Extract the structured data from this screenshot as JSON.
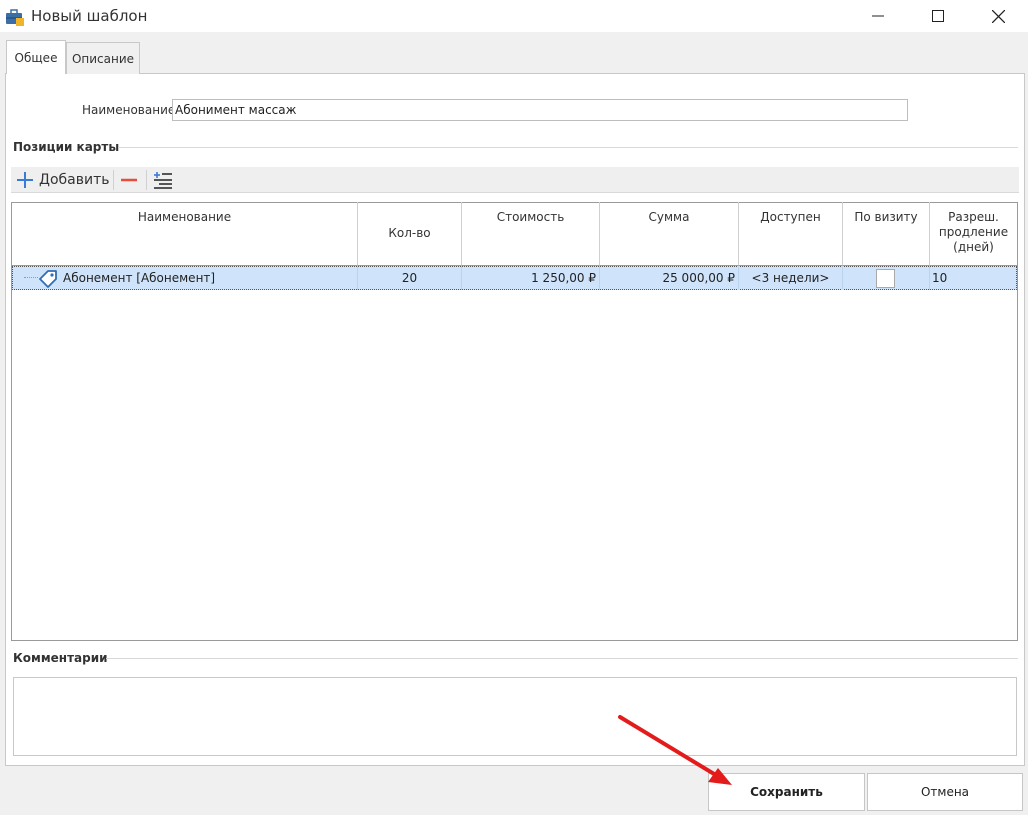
{
  "window": {
    "title": "Новый шаблон",
    "icons": {
      "app": "briefcase-icon",
      "minimize": "minimize-icon",
      "maximize": "maximize-icon",
      "close": "close-icon"
    }
  },
  "tabs": [
    {
      "label": "Общее",
      "active": true
    },
    {
      "label": "Описание",
      "active": false
    }
  ],
  "form": {
    "name_label": "Наименование:",
    "name_value": "Абонимент массаж"
  },
  "positions": {
    "title": "Позиции карты",
    "toolbar": {
      "add_label": "Добавить",
      "add_icon": "plus-icon",
      "remove_icon": "minus-icon",
      "properties_icon": "list-settings-icon"
    },
    "columns": [
      "Наименование",
      "Кол-во",
      "Стоимость",
      "Сумма",
      "Доступен",
      "По визиту",
      "Разреш. продление (дней)"
    ],
    "rows": [
      {
        "icon": "tag-icon",
        "name": "Абонемент [Абонемент]",
        "qty": "20",
        "cost": "1 250,00 ₽",
        "sum": "25 000,00 ₽",
        "available": "<3 недели>",
        "per_visit": false,
        "extension_days": "10"
      }
    ]
  },
  "comments": {
    "title": "Комментарии",
    "value": ""
  },
  "buttons": {
    "save": "Сохранить",
    "cancel": "Отмена"
  },
  "colors": {
    "selected_row": "#cfe4fb",
    "accent_blue": "#3a7bd5",
    "remove_red": "#e74c3c",
    "annotation_arrow": "#e31b1b"
  }
}
